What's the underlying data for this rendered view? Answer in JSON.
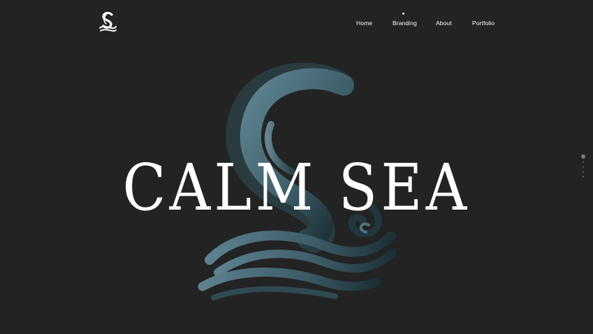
{
  "header": {
    "logo_icon": "calm-sea-wave-logo-icon",
    "nav": [
      {
        "label": "Home",
        "active": false
      },
      {
        "label": "Branding",
        "active": true
      },
      {
        "label": "About",
        "active": false
      },
      {
        "label": "Portfolio",
        "active": false
      }
    ]
  },
  "hero": {
    "title": "CALM SEA",
    "mark_icon": "s-wave-emblem-icon",
    "colors": {
      "background": "#232323",
      "title": "#ffffff",
      "emblem_light": "#5f8593",
      "emblem_dark": "#16272c"
    }
  },
  "pager": {
    "count": 5,
    "active_index": 0
  }
}
